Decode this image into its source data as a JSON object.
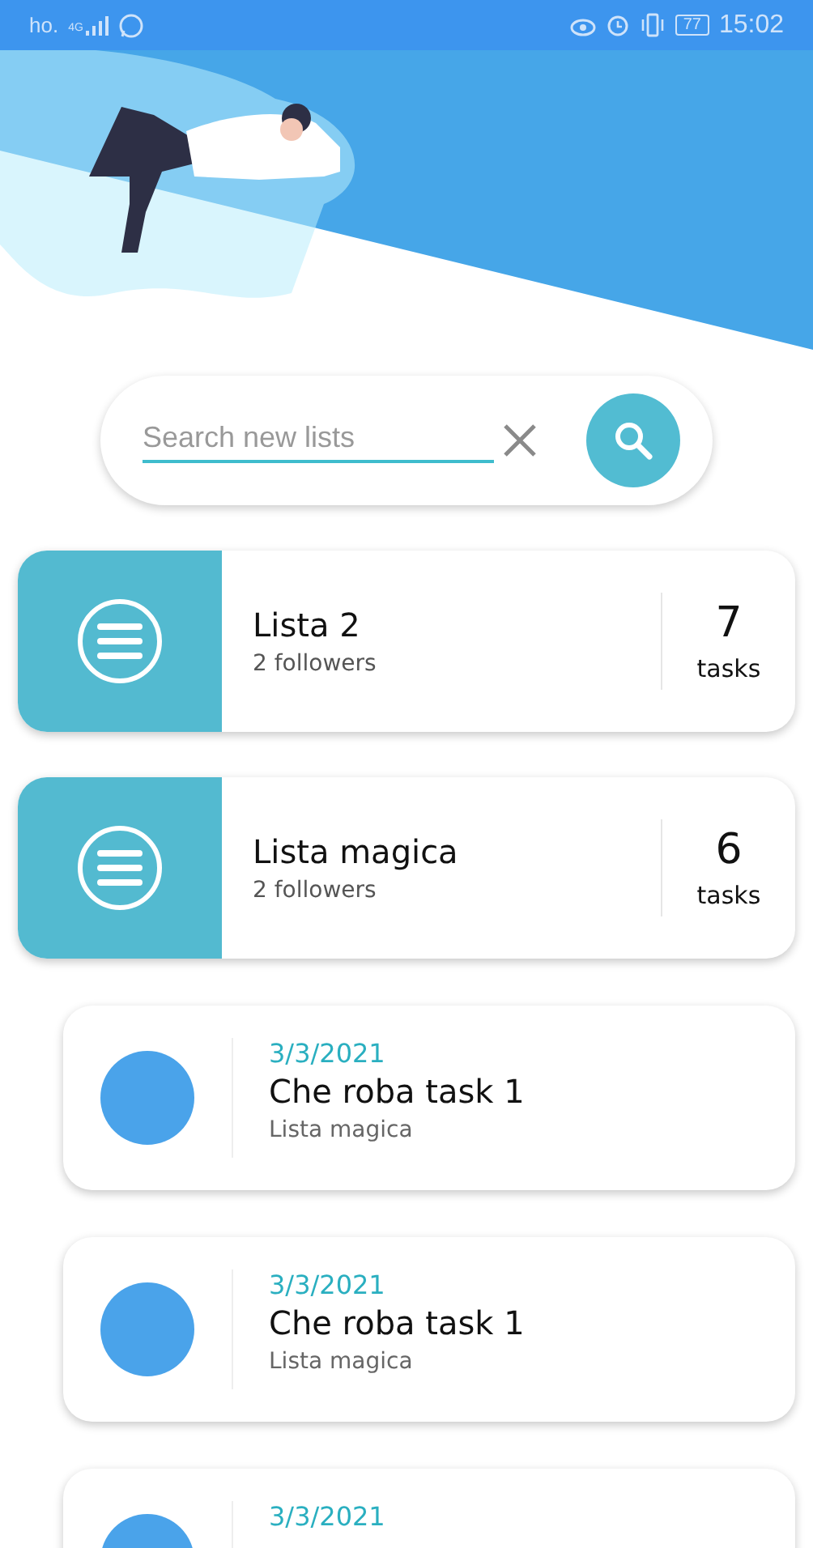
{
  "status_bar": {
    "carrier": "ho.",
    "network": "4G",
    "battery": "77",
    "time": "15:02"
  },
  "search": {
    "placeholder": "Search new lists"
  },
  "lists": [
    {
      "name": "Lista 2",
      "followers": "2 followers",
      "count": "7",
      "count_label": "tasks"
    },
    {
      "name": "Lista magica",
      "followers": "2 followers",
      "count": "6",
      "count_label": "tasks"
    }
  ],
  "tasks": [
    {
      "date": "3/3/2021",
      "title": "Che roba task 1",
      "list": "Lista magica"
    },
    {
      "date": "3/3/2021",
      "title": "Che roba task 1",
      "list": "Lista magica"
    },
    {
      "date": "3/3/2021"
    }
  ]
}
